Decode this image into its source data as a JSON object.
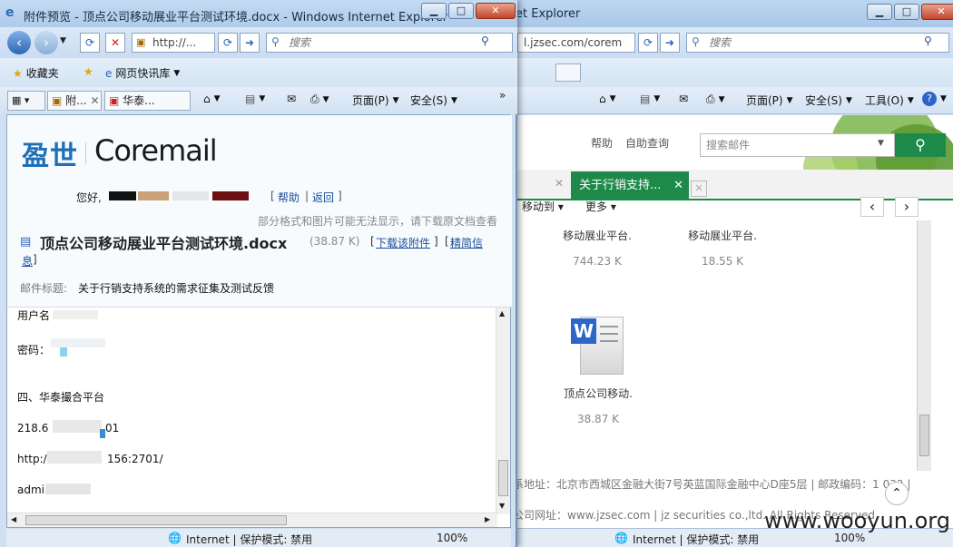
{
  "back_window": {
    "title": "et Explorer",
    "address": "l.jzsec.com/corem",
    "search_placeholder": "搜索",
    "cmd": {
      "page": "页面(P)",
      "safety": "安全(S)",
      "tools": "工具(O)"
    },
    "site_search_placeholder": "搜索邮件",
    "top_links": {
      "help": "帮助",
      "self_service": "自助查询"
    },
    "tab_active_label": "关于行销支持...",
    "toolbar": {
      "move_to": "移动到",
      "more": "更多"
    },
    "files": [
      {
        "name": "移动展业平台.",
        "size": "744.23 K"
      },
      {
        "name": "移动展业平台.",
        "size": "18.55 K"
      },
      {
        "name": "顶点公司移动.",
        "size": "38.87 K"
      }
    ],
    "footer": {
      "address": "系地址：北京市西城区金融大街7号英蓝国际金融中心D座5层 | 邮政编码：1  033 |",
      "website": "公司网址：www.jzsec.com | jz securities co.,ltd. All Rights Reserved"
    },
    "status": {
      "zone": "Internet | 保护模式: 禁用",
      "zoom": "100%"
    }
  },
  "front_window": {
    "title": "附件预览 - 顶点公司移动展业平台测试环境.docx - Windows Internet Explorer",
    "address": "http://...",
    "search_placeholder": "搜索",
    "favorites": "收藏夹",
    "web_slice": "网页快讯库",
    "tabs": [
      "附...",
      "华泰..."
    ],
    "cmd": {
      "page": "页面(P)",
      "safety": "安全(S)"
    },
    "logo_cn": "盈世",
    "logo_en": "Coremail",
    "greeting": "您好,",
    "links": {
      "help": "帮助",
      "back": "返回"
    },
    "notice": "部分格式和图片可能无法显示，请下载原文档查看",
    "doc_title": "顶点公司移动展业平台测试环境.docx",
    "doc_size": "(38.87 K)",
    "download_link": "下载该附件",
    "info_link_1": "精简信",
    "info_link_2": "息",
    "subject_label": "邮件标题:",
    "subject": "关于行销支持系统的需求征集及测试反馈",
    "body": {
      "user_label": "用户名",
      "password_label": "密码：",
      "section": "四、华泰撮合平台",
      "ip_start": "218.6",
      "ip_end": "01",
      "url_start": "http:/",
      "url_end": "156:2701/",
      "admin": "admir"
    },
    "status": {
      "zone": "Internet | 保护模式: 禁用",
      "zoom": "100%"
    }
  },
  "watermark": "www.wooyun.org"
}
